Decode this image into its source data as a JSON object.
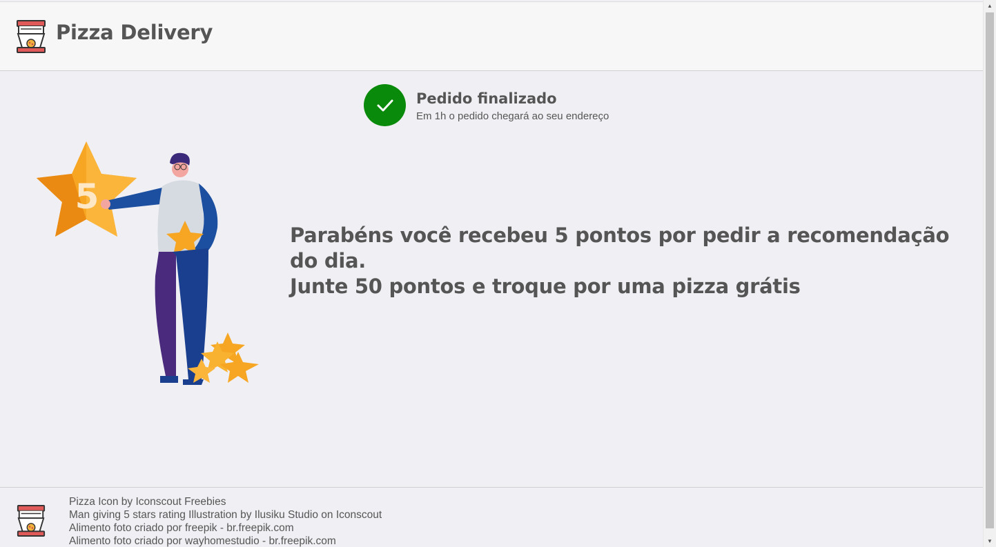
{
  "header": {
    "title": "Pizza Delivery",
    "logo_icon": "pizza-box-icon"
  },
  "status": {
    "icon": "check-icon",
    "title": "Pedido finalizado",
    "subtitle": "Em 1h o pedido chegará ao seu endereço",
    "color": "#0a8a0a"
  },
  "illustration": {
    "description_icon": "man-giving-5-stars-illustration",
    "star_number": "5"
  },
  "message": {
    "line1": "Parabéns você recebeu 5 pontos por pedir a recomendação do dia.",
    "line2": "Junte 50 pontos e troque por uma pizza grátis"
  },
  "footer": {
    "logo_icon": "pizza-box-icon",
    "credits": [
      "Pizza Icon by Iconscout Freebies",
      "Man giving 5 stars rating Illustration by Ilusiku Studio on Iconscout",
      "Alimento foto criado por freepik - br.freepik.com",
      "Alimento foto criado por wayhomestudio - br.freepik.com"
    ]
  },
  "scrollbar": {
    "up_icon": "arrow-up-icon",
    "down_icon": "arrow-down-icon"
  }
}
